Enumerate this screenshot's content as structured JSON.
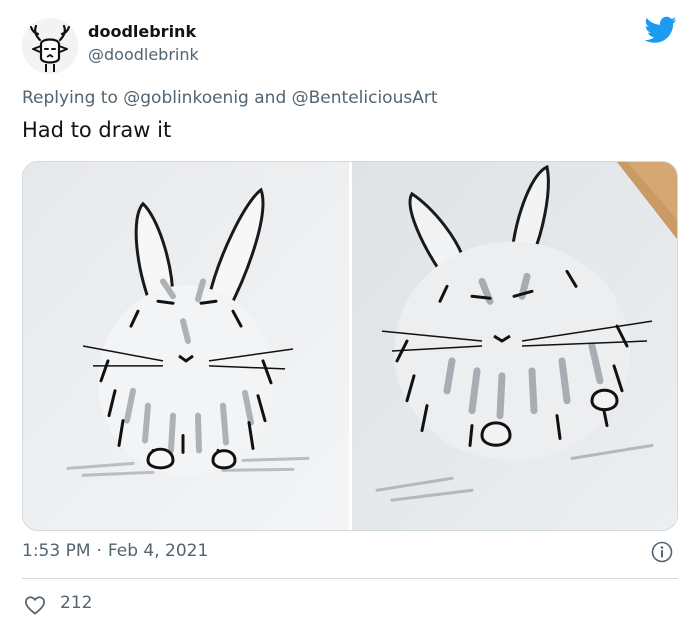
{
  "author": {
    "display_name": "doodlebrink",
    "handle": "@doodlebrink",
    "avatar_icon": "stag-doodle-avatar"
  },
  "reply": {
    "prefix": "Replying to",
    "mention_1": "@goblinkoenig",
    "conjunction": "and",
    "mention_2": "@BenteliciousArt"
  },
  "tweet": {
    "text": "Had to draw it"
  },
  "media": {
    "count": 2,
    "items": [
      {
        "icon": "bunny-drawing-photo"
      },
      {
        "icon": "bunny-drawing-photo-angled"
      }
    ]
  },
  "meta": {
    "time": "1:53 PM",
    "separator": "·",
    "date": "Feb 4, 2021"
  },
  "stats": {
    "likes": "212"
  },
  "colors": {
    "brand_blue": "#1d9bf0",
    "secondary_text": "#536471",
    "primary_text": "#0f1419",
    "divider": "#cfd9de"
  }
}
